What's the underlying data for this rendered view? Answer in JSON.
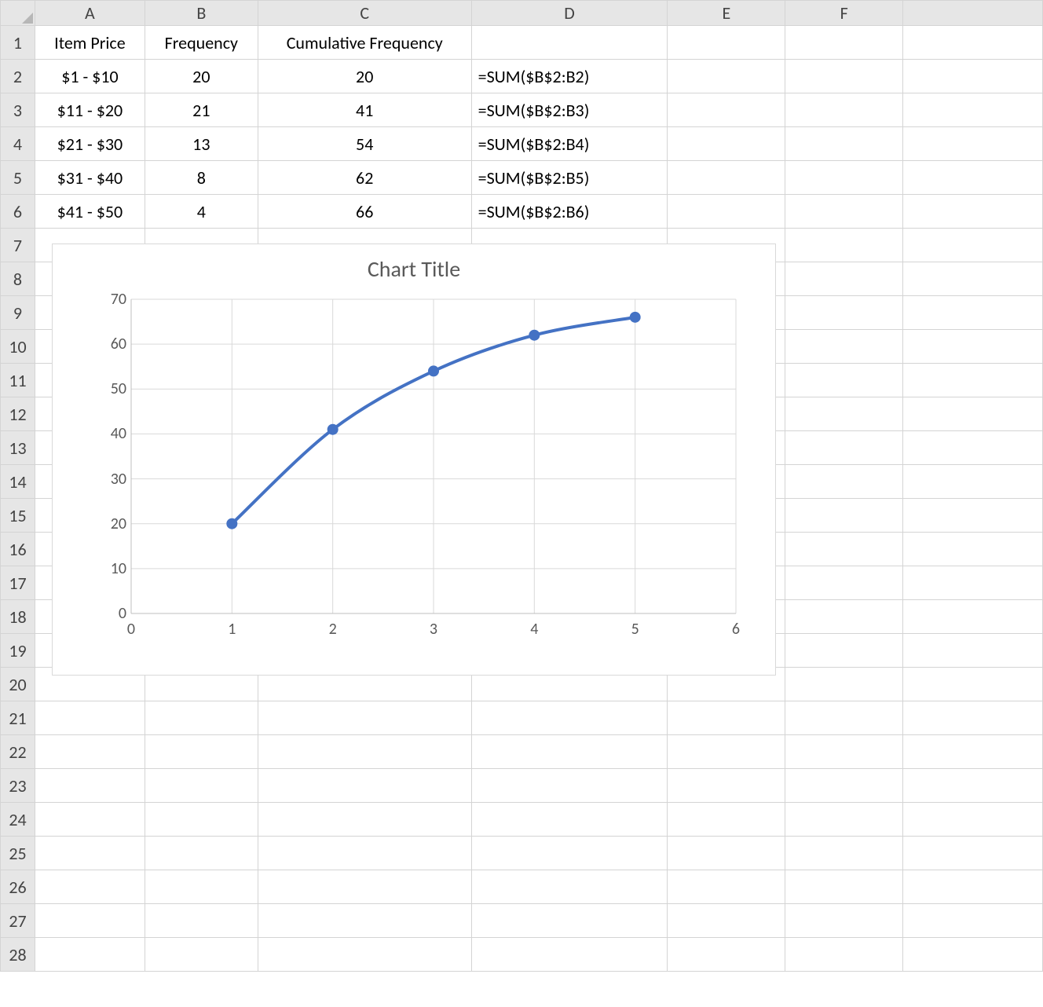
{
  "columns": [
    "A",
    "B",
    "C",
    "D",
    "E",
    "F",
    ""
  ],
  "row_numbers": [
    "1",
    "2",
    "3",
    "4",
    "5",
    "6",
    "7",
    "8",
    "9",
    "10",
    "11",
    "12",
    "13",
    "14",
    "15",
    "16",
    "17",
    "18",
    "19",
    "20",
    "21",
    "22",
    "23",
    "24",
    "25",
    "26",
    "27",
    "28"
  ],
  "headers": {
    "A": "Item Price",
    "B": "Frequency",
    "C": "Cumulative Frequency"
  },
  "rows": [
    {
      "A": "$1 - $10",
      "B": "20",
      "C": "20",
      "D": "=SUM($B$2:B2)"
    },
    {
      "A": "$11 - $20",
      "B": "21",
      "C": "41",
      "D": "=SUM($B$2:B3)"
    },
    {
      "A": "$21 - $30",
      "B": "13",
      "C": "54",
      "D": "=SUM($B$2:B4)"
    },
    {
      "A": "$31 - $40",
      "B": "8",
      "C": "62",
      "D": "=SUM($B$2:B5)"
    },
    {
      "A": "$41 - $50",
      "B": "4",
      "C": "66",
      "D": "=SUM($B$2:B6)"
    }
  ],
  "chart_data": {
    "type": "line",
    "title": "Chart Title",
    "x": [
      1,
      2,
      3,
      4,
      5
    ],
    "values": [
      20,
      41,
      54,
      62,
      66
    ],
    "x_ticks": [
      0,
      1,
      2,
      3,
      4,
      5,
      6
    ],
    "y_ticks": [
      0,
      10,
      20,
      30,
      40,
      50,
      60,
      70
    ],
    "xlim": [
      0,
      6
    ],
    "ylim": [
      0,
      70
    ],
    "series_color": "#4472C4",
    "marker_color": "#4472C4"
  }
}
